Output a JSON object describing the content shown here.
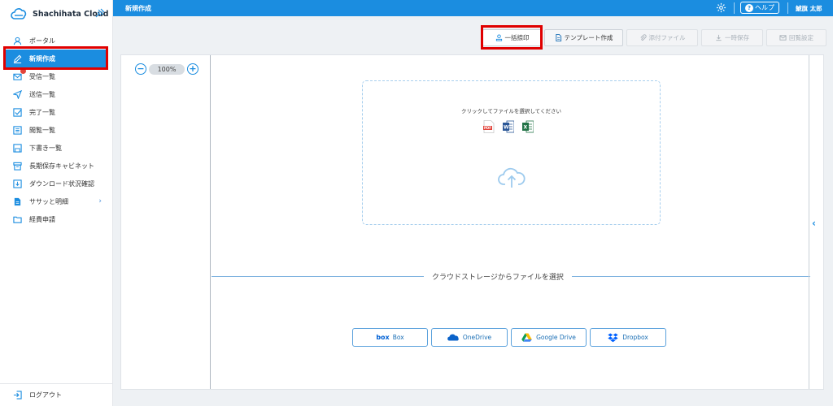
{
  "brand": {
    "name": "Shachihata Cloud"
  },
  "sidebar": {
    "items": [
      {
        "label": "ポータル",
        "icon": "user-icon"
      },
      {
        "label": "新規作成",
        "icon": "pen-icon",
        "active": true
      },
      {
        "label": "受信一覧",
        "icon": "mail-icon",
        "badge": true
      },
      {
        "label": "送信一覧",
        "icon": "send-icon"
      },
      {
        "label": "完了一覧",
        "icon": "check-icon"
      },
      {
        "label": "閲覧一覧",
        "icon": "list-icon"
      },
      {
        "label": "下書き一覧",
        "icon": "save-icon"
      },
      {
        "label": "長期保存キャビネット",
        "icon": "archive-icon"
      },
      {
        "label": "ダウンロード状況確認",
        "icon": "download-icon"
      },
      {
        "label": "ササッと明細",
        "icon": "doc-icon",
        "chevron": "›"
      },
      {
        "label": "経費申請",
        "icon": "folder-icon"
      }
    ],
    "logout": "ログアウト"
  },
  "topbar": {
    "title": "新規作成",
    "help": "ヘルプ",
    "user": "鯱旗 太郎"
  },
  "toolbar": {
    "bulk_stamp": "一括捺印",
    "template": "テンプレート作成",
    "attach": "添付ファイル",
    "temp_save": "一時保存",
    "view_settings": "回覧設定"
  },
  "viewer": {
    "zoom": "100%",
    "zoom_out": "−",
    "zoom_in": "+",
    "collapse": "‹"
  },
  "upload": {
    "prompt": "クリックしてファイルを選択してください",
    "file_types": [
      "pdf-icon",
      "word-icon",
      "excel-icon"
    ]
  },
  "cloud_storage": {
    "label": "クラウドストレージからファイルを選択",
    "providers": [
      "Box",
      "OneDrive",
      "Google Drive",
      "Dropbox"
    ],
    "box_logo": "box"
  },
  "colors": {
    "accent": "#1b8de0",
    "highlight": "#e00000"
  }
}
